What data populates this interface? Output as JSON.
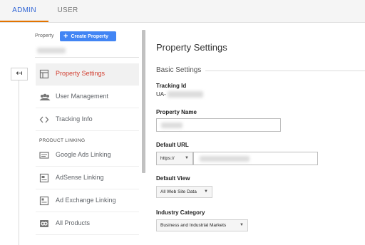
{
  "tabs": [
    {
      "label": "ADMIN",
      "active": true
    },
    {
      "label": "USER",
      "active": false
    }
  ],
  "back_button": {
    "icon": "back-arrow-icon",
    "glyph": "↤"
  },
  "property": {
    "label": "Property",
    "create_button": {
      "label": "Create Property",
      "icon": "plus-icon",
      "glyph": "+"
    }
  },
  "nav": {
    "items": [
      {
        "label": "Property Settings",
        "icon": "property-settings-icon",
        "active": true
      },
      {
        "label": "User Management",
        "icon": "users-icon",
        "active": false
      },
      {
        "label": "Tracking Info",
        "icon": "code-icon",
        "active": false
      }
    ],
    "section_label": "PRODUCT LINKING",
    "linking_items": [
      {
        "label": "Google Ads Linking",
        "icon": "google-ads-icon"
      },
      {
        "label": "AdSense Linking",
        "icon": "adsense-icon"
      },
      {
        "label": "Ad Exchange Linking",
        "icon": "ad-exchange-icon"
      },
      {
        "label": "All Products",
        "icon": "link-icon"
      }
    ]
  },
  "main": {
    "title": "Property Settings",
    "section": "Basic Settings",
    "tracking_id": {
      "label": "Tracking Id",
      "prefix": "UA-"
    },
    "property_name": {
      "label": "Property Name"
    },
    "default_url": {
      "label": "Default URL",
      "protocol": "https://"
    },
    "default_view": {
      "label": "Default View",
      "value": "All Web Site Data"
    },
    "industry": {
      "label": "Industry Category",
      "value": "Business and Industrial Markets"
    }
  },
  "colors": {
    "accent_blue": "#3367d6",
    "tab_underline": "#e37400",
    "active_red": "#d23f31",
    "button_blue": "#4285f4"
  }
}
